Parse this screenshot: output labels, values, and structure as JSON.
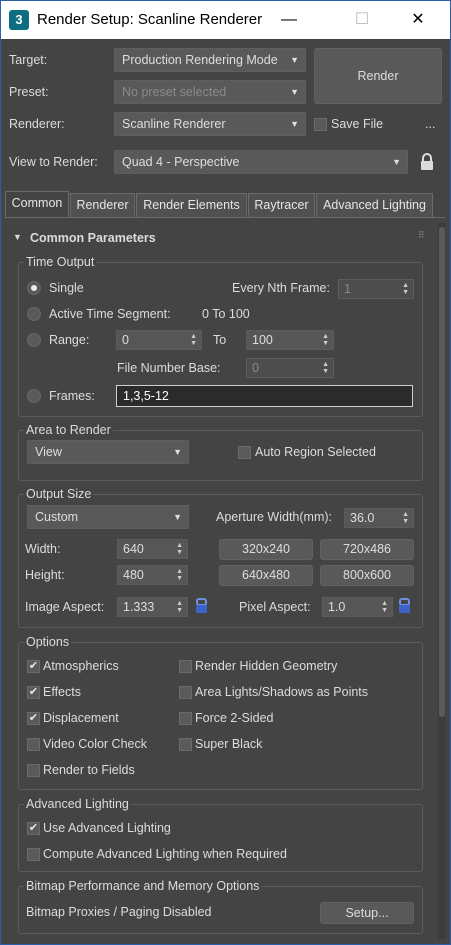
{
  "window": {
    "title": "Render Setup: Scanline Renderer",
    "app_icon_glyph": "3",
    "minimize_glyph": "—",
    "maximize_glyph": "☐",
    "close_glyph": "✕"
  },
  "top": {
    "target_label": "Target:",
    "target_value": "Production Rendering Mode",
    "preset_label": "Preset:",
    "preset_value": "No preset selected",
    "renderer_label": "Renderer:",
    "renderer_value": "Scanline Renderer",
    "save_file_label": "Save File",
    "save_file_checked": false,
    "more_label": "...",
    "render_button": "Render",
    "view_label": "View to Render:",
    "view_value": "Quad 4 - Perspective"
  },
  "tabs": [
    {
      "label": "Common",
      "active": true
    },
    {
      "label": "Renderer",
      "active": false
    },
    {
      "label": "Render Elements",
      "active": false
    },
    {
      "label": "Raytracer",
      "active": false
    },
    {
      "label": "Advanced Lighting",
      "active": false
    }
  ],
  "rollout": {
    "title": "Common Parameters",
    "collapse_glyph": "▼"
  },
  "time_output": {
    "title": "Time Output",
    "single_label": "Single",
    "every_nth_label": "Every Nth Frame:",
    "every_nth_value": "1",
    "active_segment_label": "Active Time Segment:",
    "active_segment_value": "0 To 100",
    "range_label": "Range:",
    "range_from": "0",
    "to_label": "To",
    "range_to": "100",
    "file_number_base_label": "File Number Base:",
    "file_number_base_value": "0",
    "frames_label": "Frames:",
    "frames_value": "1,3,5-12",
    "selected": "single"
  },
  "area_to_render": {
    "title": "Area to Render",
    "value": "View",
    "auto_region_label": "Auto Region Selected"
  },
  "output_size": {
    "title": "Output Size",
    "preset_value": "Custom",
    "aperture_label": "Aperture Width(mm):",
    "aperture_value": "36.0",
    "width_label": "Width:",
    "width_value": "640",
    "height_label": "Height:",
    "height_value": "480",
    "presets": [
      "320x240",
      "720x486",
      "640x480",
      "800x600"
    ],
    "image_aspect_label": "Image Aspect:",
    "image_aspect_value": "1.333",
    "pixel_aspect_label": "Pixel Aspect:",
    "pixel_aspect_value": "1.0"
  },
  "options": {
    "title": "Options",
    "atmospherics": "Atmospherics",
    "effects": "Effects",
    "displacement": "Displacement",
    "video_color_check": "Video Color Check",
    "render_to_fields": "Render to Fields",
    "render_hidden_geometry": "Render Hidden Geometry",
    "area_lights": "Area Lights/Shadows as Points",
    "force_2_sided": "Force 2-Sided",
    "super_black": "Super Black"
  },
  "advanced_lighting": {
    "title": "Advanced Lighting",
    "use_label": "Use Advanced Lighting",
    "compute_label": "Compute Advanced Lighting when Required"
  },
  "bitmap": {
    "title": "Bitmap Performance and Memory Options",
    "status": "Bitmap Proxies / Paging Disabled",
    "setup_button": "Setup..."
  },
  "glyphs": {
    "check": "✔",
    "dropdown_arrow": "▼",
    "spinner": "▲▼"
  }
}
